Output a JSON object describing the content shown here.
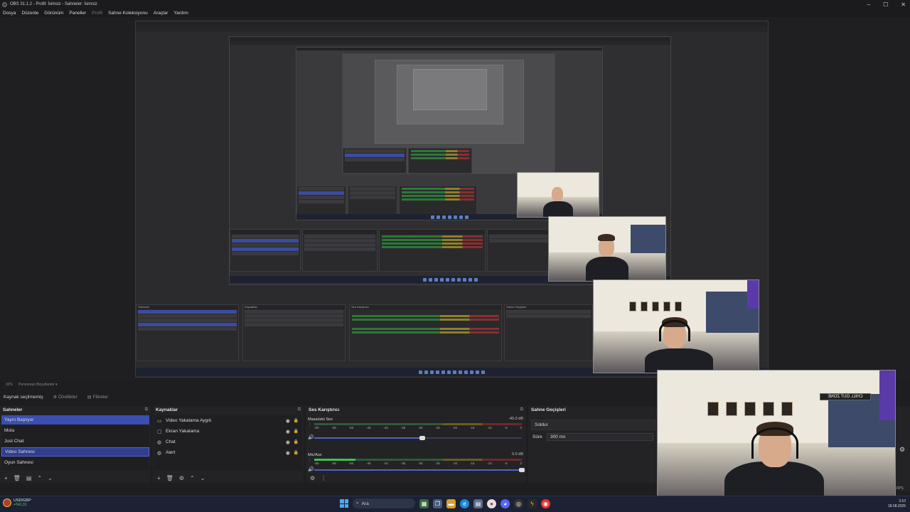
{
  "window": {
    "title": "OBS 31.1.2 - Profil: İsimsiz - Sahneler: İsimsiz",
    "controls": [
      "–",
      "☐",
      "✕"
    ]
  },
  "menu": {
    "items": [
      "Dosya",
      "Düzenle",
      "Görünüm",
      "Paneller",
      "Profil",
      "Sahne Koleksiyonu",
      "Araçlar",
      "Yardım"
    ]
  },
  "preview": {
    "zoom": "32%",
    "scale_mode": "Pencereye Boyutlandır"
  },
  "source_toolbar": {
    "no_source_label": "Kaynak seçilmemiş",
    "properties_label": "Özellikler",
    "filters_label": "Filtreler"
  },
  "scenes": {
    "title": "Sahneler",
    "items": [
      {
        "label": "Yayın Başlıyor",
        "state": "selected"
      },
      {
        "label": "Mola",
        "state": ""
      },
      {
        "label": "Just Chat",
        "state": ""
      },
      {
        "label": "Video Sahnesi",
        "state": "program"
      },
      {
        "label": "Oyun Sahnesi",
        "state": ""
      }
    ]
  },
  "sources": {
    "title": "Kaynaklar",
    "items": [
      {
        "label": "Video Yakalama Aygıtı",
        "icon": "camera-icon"
      },
      {
        "label": "Ekran Yakalama",
        "icon": "monitor-icon"
      },
      {
        "label": "Chat",
        "icon": "browser-icon"
      },
      {
        "label": "Alert",
        "icon": "browser-icon"
      }
    ]
  },
  "mixer": {
    "title": "Ses Karıştırıcı",
    "tracks": [
      {
        "name": "Masaüstü Ses",
        "db": "-45.0 dB",
        "level": 0.0,
        "volume": 0.52
      },
      {
        "name": "Mic/Aux",
        "db": "0.0 dB",
        "level": 0.2,
        "volume": 1.0
      }
    ],
    "ticks": [
      "-60",
      "-55",
      "-50",
      "-45",
      "-40",
      "-35",
      "-30",
      "-25",
      "-20",
      "-15",
      "-10",
      "-5",
      "0"
    ]
  },
  "transitions": {
    "title": "Sahne Geçişleri",
    "selected": "Soldur",
    "duration_label": "Süre",
    "duration_value": "300 ms"
  },
  "statusbar": {
    "fps": "FPS"
  },
  "taskbar": {
    "ticker_pair": "USD/GBP",
    "ticker_change": "+%0,31",
    "search_placeholder": "Ara",
    "time": "3:10",
    "date": "18.08.2025"
  },
  "webcam": {
    "sign_text": "CHILL OUT ZONE"
  },
  "colors": {
    "accent": "#3c4eb0",
    "meter_green": "#42c04c",
    "meter_yellow": "#a8962a",
    "meter_red": "#a0302e"
  }
}
